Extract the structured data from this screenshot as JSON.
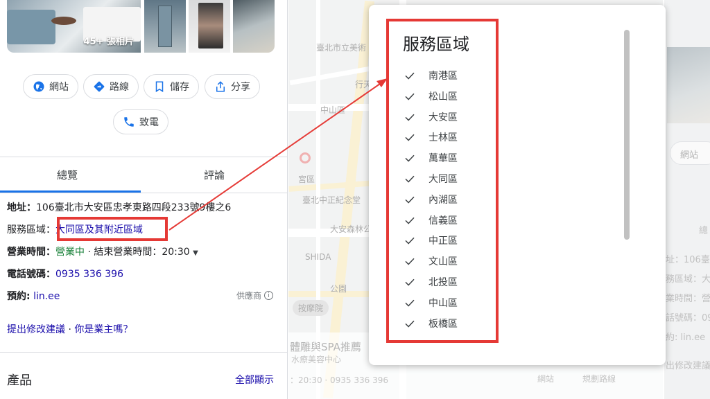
{
  "photos": {
    "count_label": "45+ 張相片"
  },
  "actions": [
    {
      "label": "網站",
      "icon": "globe-icon"
    },
    {
      "label": "路線",
      "icon": "directions-icon"
    },
    {
      "label": "儲存",
      "icon": "bookmark-icon"
    },
    {
      "label": "分享",
      "icon": "share-icon"
    },
    {
      "label": "致電",
      "icon": "phone-icon"
    }
  ],
  "tabs": [
    {
      "label": "總覽",
      "active": true
    },
    {
      "label": "評論",
      "active": false
    }
  ],
  "info": {
    "address_label": "地址：",
    "address_value": "106臺北市大安區忠孝東路四段233號9樓之6",
    "service_area_label": "服務區域：",
    "service_area_value": "大同區及其附近區域",
    "hours_label": "營業時間：",
    "hours_status": "營業中",
    "hours_detail": "· 結束營業時間：20:30",
    "phone_label": "電話號碼：",
    "phone_value": "0935 336 396",
    "booking_label": "預約:",
    "booking_value": "lin.ee",
    "provider_label": "供應商",
    "suggest_edit": "提出修改建議",
    "separator": "·",
    "own_business": "你是業主嗎？"
  },
  "products": {
    "title": "產品",
    "show_all": "全部顯示"
  },
  "popup": {
    "title": "服務區域",
    "areas": [
      "南港區",
      "松山區",
      "大安區",
      "士林區",
      "萬華區",
      "大同區",
      "內湖區",
      "信義區",
      "中正區",
      "文山區",
      "北投區",
      "中山區",
      "板橋區"
    ]
  },
  "map": {
    "labels": [
      "臺北市立美術",
      "行天",
      "中山區",
      "宮區",
      "臺北中正紀念堂",
      "大安森林公",
      "SHIDA",
      "公園",
      "按摩院"
    ],
    "listing_title": "體雕與SPA推薦",
    "listing_subtitle": "水療美容中心",
    "listing_hours": "：20:30 · 0935 336 396",
    "btn_website": "網站",
    "btn_route": "規劃路線"
  },
  "ghost": {
    "chip": "網站",
    "tab": "總",
    "lines": [
      "址：106臺",
      "務區域：大",
      "業時間：營",
      "話號碼：09",
      "約: lin.ee",
      "出修改建議"
    ]
  },
  "colors": {
    "accent": "#1a73e8",
    "highlight": "#e53935",
    "link": "#1a0dab",
    "open": "#188038"
  }
}
